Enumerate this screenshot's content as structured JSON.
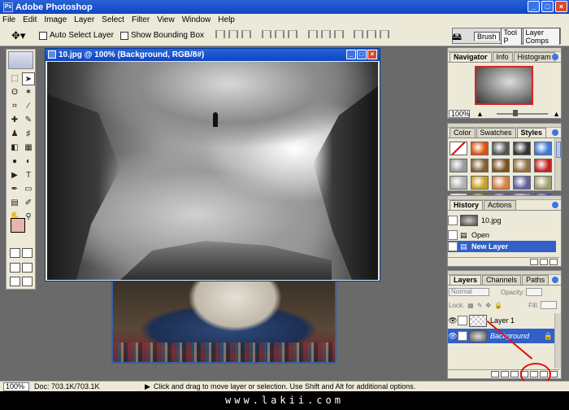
{
  "app": {
    "title": "Adobe Photoshop",
    "logo_text": "Ps"
  },
  "window_buttons": [
    "_",
    "□",
    "×"
  ],
  "menu": [
    "File",
    "Edit",
    "Image",
    "Layer",
    "Select",
    "Filter",
    "View",
    "Window",
    "Help"
  ],
  "options_bar": {
    "auto_select": "Auto Select Layer",
    "bounding_box": "Show Bounding Box",
    "palette_tabs": [
      "Brush",
      "Tool P",
      "Layer Comps"
    ]
  },
  "document": {
    "title": "10.jpg @ 100% (Background, RGB/8#)"
  },
  "navigator": {
    "tabs": [
      "Navigator",
      "Info",
      "Histogram"
    ],
    "zoom": "100%"
  },
  "styles_panel": {
    "tabs": [
      "Color",
      "Swatches",
      "Styles"
    ],
    "swatches": [
      "#ffffff",
      "#e05010",
      "#555555",
      "#333333",
      "#3a7ad8",
      "#999999",
      "#806030",
      "#7a5020",
      "#907040",
      "#c02020",
      "#b0b0b0",
      "#c8a020",
      "#d88040",
      "#6060a0",
      "#a0a070",
      "#d0d0d0",
      "#806040",
      "#7050a0",
      "#9080d0",
      "#4050b0"
    ]
  },
  "history": {
    "tabs": [
      "History",
      "Actions"
    ],
    "snapshot": "10.jpg",
    "items": [
      "Open",
      "New Layer"
    ]
  },
  "layers": {
    "tabs": [
      "Layers",
      "Channels",
      "Paths"
    ],
    "blend_mode": "Normal",
    "opacity_label": "Opacity:",
    "lock_label": "Lock:",
    "fill_label": "Fill:",
    "items": [
      {
        "name": "Layer 1"
      },
      {
        "name": "Background"
      }
    ]
  },
  "status": {
    "zoom": "100%",
    "doc": "Doc: 703.1K/703.1K",
    "hint": "Click and drag to move layer or selection.  Use Shift and Alt for additional options."
  },
  "footer": {
    "watermark": "www.lakii.com"
  }
}
